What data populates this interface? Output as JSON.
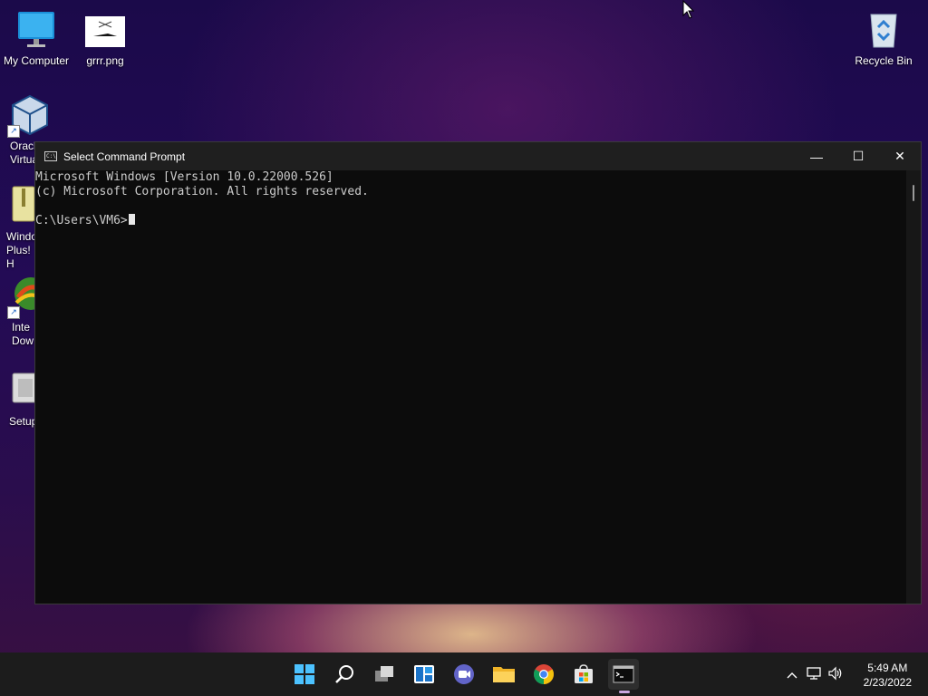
{
  "desktop": {
    "icons": [
      {
        "label": "My Computer",
        "icon": "monitor-icon"
      },
      {
        "label": "grrr.png",
        "icon": "image-file-icon"
      },
      {
        "label": "Recycle Bin",
        "icon": "recycle-bin-icon"
      },
      {
        "label": "Oracl Virtua",
        "icon": "virtualbox-icon"
      },
      {
        "label": "Windo Plus! H",
        "icon": "folder-zip-icon"
      },
      {
        "label": "Inte Dow",
        "icon": "download-manager-icon"
      },
      {
        "label": "Setup",
        "icon": "setup-icon"
      }
    ]
  },
  "window": {
    "title": "Select Command Prompt",
    "console_lines": [
      "Microsoft Windows [Version 10.0.22000.526]",
      "(c) Microsoft Corporation. All rights reserved.",
      "",
      "C:\\Users\\VM6>"
    ],
    "controls": {
      "minimize": "—",
      "maximize": "☐",
      "close": "✕"
    }
  },
  "taskbar": {
    "apps": [
      {
        "name": "start",
        "icon": "windows-start-icon"
      },
      {
        "name": "search",
        "icon": "search-icon"
      },
      {
        "name": "task-view",
        "icon": "task-view-icon"
      },
      {
        "name": "widgets",
        "icon": "widgets-icon"
      },
      {
        "name": "chat",
        "icon": "teams-chat-icon"
      },
      {
        "name": "file-explorer",
        "icon": "folder-icon"
      },
      {
        "name": "chrome",
        "icon": "chrome-icon"
      },
      {
        "name": "store",
        "icon": "store-icon"
      },
      {
        "name": "command-prompt",
        "icon": "terminal-icon",
        "active": true
      }
    ],
    "tray": {
      "chevron": "^",
      "time": "5:49 AM",
      "date": "2/23/2022"
    }
  },
  "colors": {
    "console_bg": "#0c0c0c",
    "console_text": "#cccccc",
    "taskbar_bg": "#1c1c1c",
    "accent": "#0078d4"
  }
}
